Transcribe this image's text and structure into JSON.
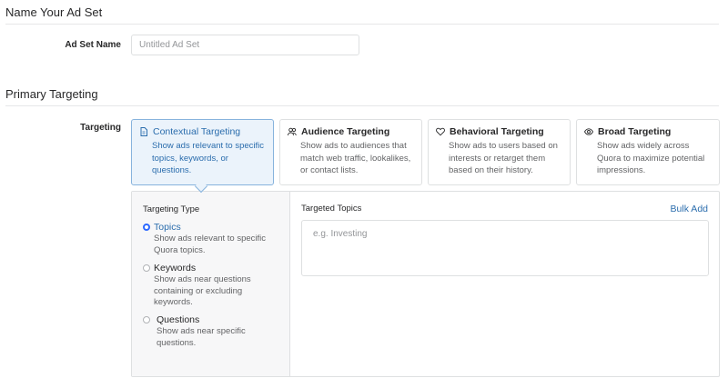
{
  "ad_set": {
    "section_title": "Name Your Ad Set",
    "name_label": "Ad Set Name",
    "name_placeholder": "Untitled Ad Set",
    "name_value": ""
  },
  "primary_targeting": {
    "section_title": "Primary Targeting",
    "targeting_label": "Targeting",
    "options": [
      {
        "id": "contextual",
        "icon": "document-icon",
        "title": "Contextual Targeting",
        "description": "Show ads relevant to specific topics, keywords, or questions.",
        "selected": true
      },
      {
        "id": "audience",
        "icon": "people-icon",
        "title": "Audience Targeting",
        "description": "Show ads to audiences that match web traffic, lookalikes, or contact lists.",
        "selected": false
      },
      {
        "id": "behavioral",
        "icon": "heart-icon",
        "title": "Behavioral Targeting",
        "description": "Show ads to users based on interests or retarget them based on their history.",
        "selected": false
      },
      {
        "id": "broad",
        "icon": "eye-icon",
        "title": "Broad Targeting",
        "description": "Show ads widely across Quora to maximize potential impressions.",
        "selected": false
      }
    ]
  },
  "targeting_type": {
    "heading": "Targeting Type",
    "options": [
      {
        "label": "Topics",
        "description": "Show ads relevant to specific Quora topics.",
        "checked": true
      },
      {
        "label": "Keywords",
        "description": "Show ads near questions containing or excluding keywords.",
        "checked": false
      },
      {
        "label": "Questions",
        "description": "Show ads near specific questions.",
        "checked": false
      }
    ]
  },
  "targeted_topics": {
    "heading": "Targeted Topics",
    "bulk_add_label": "Bulk Add",
    "placeholder": "e.g. Investing",
    "value": ""
  },
  "colors": {
    "accent": "#2b6dad",
    "selected_bg": "#ebf3fb",
    "selected_border": "#87b3dd",
    "radio_active": "#2e69ff"
  }
}
